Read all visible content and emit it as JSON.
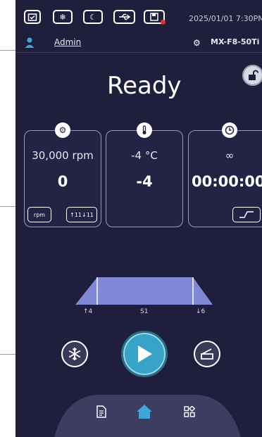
{
  "status_bar": {
    "icons": [
      "calendar-check-icon",
      "snowflake-icon",
      "moon-icon",
      "usb-icon",
      "save-icon"
    ],
    "datetime": "2025/01/01  7:30PM"
  },
  "user": {
    "name": "Admin",
    "icon": "user-icon"
  },
  "device": {
    "model": "MX-F8-50Ti",
    "icon": "gear-icon"
  },
  "status": {
    "text": "Ready"
  },
  "speed": {
    "setpoint": "30,000  rpm",
    "value": "0",
    "unit_button": "rpm",
    "accel_button": "↑11↓11"
  },
  "temperature": {
    "setpoint": "-4 °C",
    "value": "-4"
  },
  "timer": {
    "setpoint": "∞",
    "value": "00:00:00"
  },
  "profile": {
    "accel_label": "↑4",
    "step_label": "S1",
    "decel_label": "↓6"
  },
  "colors": {
    "background": "#1f1f3d",
    "accent": "#37a3c6",
    "profile_fill": "#7f88d6"
  }
}
